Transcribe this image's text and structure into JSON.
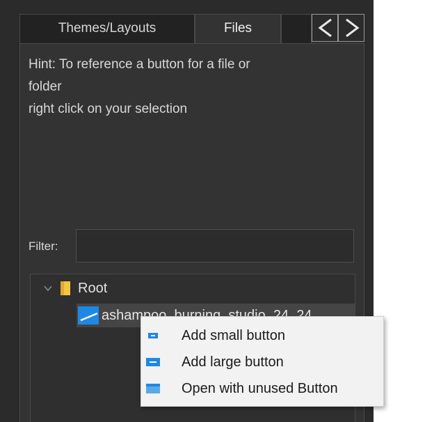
{
  "tabs": {
    "themes_layouts": "Themes/Layouts",
    "files": "Files",
    "prev_icon": "chevron-left-icon",
    "next_icon": "chevron-right-icon"
  },
  "hint": {
    "line1": "Hint: To reference a button for a file or",
    "line2": "folder",
    "line3": "right click on your selection"
  },
  "filter": {
    "label": "Filter:",
    "value": ""
  },
  "tree": {
    "root_label": "Root",
    "child_label": "ashampoo_burning_studio_24_24"
  },
  "context_menu": {
    "items": [
      {
        "label": "Add small button",
        "icon": "small-button-icon"
      },
      {
        "label": "Add large button",
        "icon": "large-button-icon"
      },
      {
        "label": "Open with unused Button",
        "icon": "unused-button-icon"
      }
    ]
  },
  "colors": {
    "panel_bg": "#2b2b2b",
    "content_bg": "#333333",
    "accent_blue": "#1e88e5",
    "folder_yellow": "#f4c542",
    "menu_bg": "#f2f2f2"
  }
}
